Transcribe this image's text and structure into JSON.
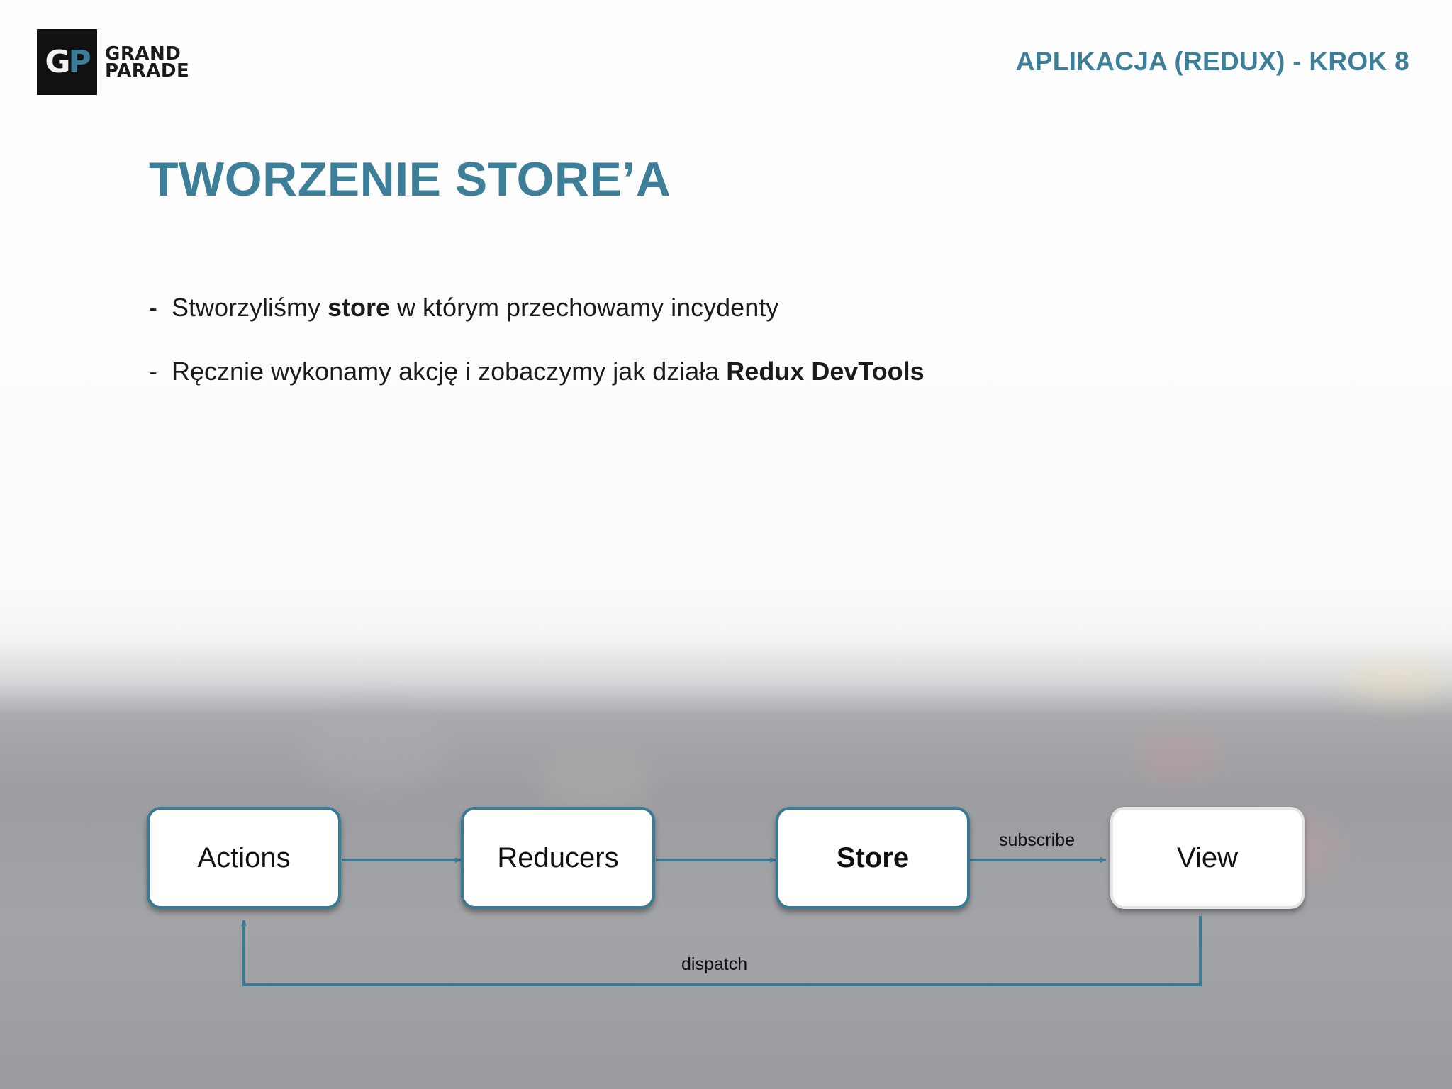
{
  "logo": {
    "mark_g": "G",
    "mark_p": "P",
    "line1": "GRAND",
    "line2": "PARADE"
  },
  "header": {
    "title": "APLIKACJA (REDUX) - KROK 8"
  },
  "slide": {
    "title": "TWORZENIE STORE’A",
    "bullets": [
      {
        "dash": "-",
        "before": "Stworzyliśmy ",
        "bold": "store",
        "after": " w którym przechowamy incydenty"
      },
      {
        "dash": "-",
        "before": "Ręcznie wykonamy akcję i zobaczymy jak działa ",
        "bold": "Redux DevTools",
        "after": ""
      }
    ]
  },
  "diagram": {
    "nodes": {
      "actions": "Actions",
      "reducers": "Reducers",
      "store": "Store",
      "view": "View"
    },
    "edges": {
      "subscribe": "subscribe",
      "dispatch": "dispatch"
    }
  },
  "colors": {
    "accent": "#3d7f99",
    "edge": "#3a7a95"
  }
}
